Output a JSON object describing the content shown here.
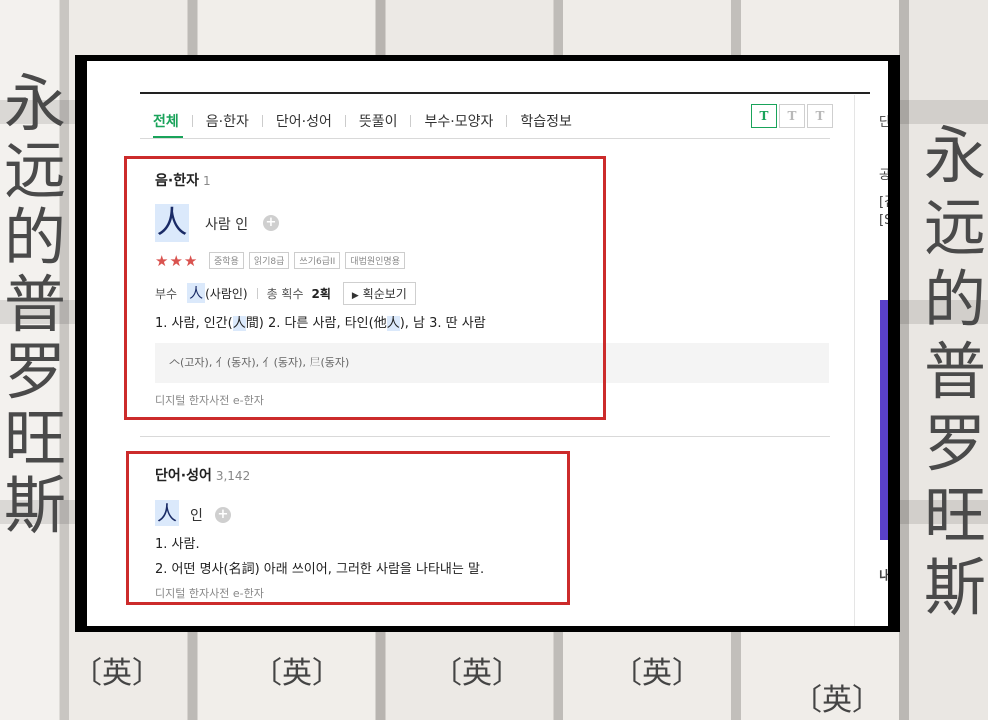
{
  "background": {
    "left_chars": [
      "永",
      "远",
      "的",
      "普",
      "罗",
      "旺",
      "斯"
    ],
    "right_chars": [
      "永",
      "远",
      "的",
      "普",
      "罗",
      "旺",
      "斯"
    ],
    "spine_char": "〔英〕"
  },
  "tabs": [
    {
      "label": "전체",
      "active": true
    },
    {
      "label": "음·한자",
      "active": false
    },
    {
      "label": "단어·성어",
      "active": false
    },
    {
      "label": "뜻풀이",
      "active": false
    },
    {
      "label": "부수·모양자",
      "active": false
    },
    {
      "label": "학습정보",
      "active": false
    }
  ],
  "font_size_buttons": [
    "T",
    "T",
    "T"
  ],
  "right_column": {
    "cut_texts": [
      "단",
      "공",
      "[검",
      "[S",
      "내"
    ]
  },
  "hanja_section": {
    "title": "음·한자",
    "count": "1",
    "character": "人",
    "reading": "사람 인",
    "plus": "+",
    "stars": "★★★",
    "badges": [
      "중학용",
      "읽기8급",
      "쓰기6급II",
      "대법원인명용"
    ],
    "radical_label": "부수",
    "radical_char": "人",
    "radical_name": "(사람인)",
    "stroke_label": "총 획수",
    "stroke_value": "2획",
    "stroke_button": "획순보기",
    "meaning_parts": [
      "1. 사람, 인간(",
      "人",
      "間)  2. 다른 사람, 타인(他",
      "人",
      "), 남  3. 딴 사람"
    ],
    "variants": "𠆢(고자), 亻(동자), 亻(동자), 𡰥(동자)",
    "source": "디지털 한자사전 e-한자"
  },
  "word_section": {
    "title": "단어·성어",
    "count": "3,142",
    "character": "人",
    "reading": "인",
    "plus": "+",
    "meaning_1": "1. 사람.",
    "meaning_2": "2. 어떤 명사(名詞) 아래 쓰이어, 그러한 사람을 나타내는 말.",
    "source": "디지털 한자사전 e-한자"
  },
  "colors": {
    "accent_green": "#19a35a",
    "highlight_red": "#cc2b2b",
    "star_red": "#d9534f",
    "hanja_bg": "#dbe9fb",
    "purple_bar": "#5a40c8"
  }
}
